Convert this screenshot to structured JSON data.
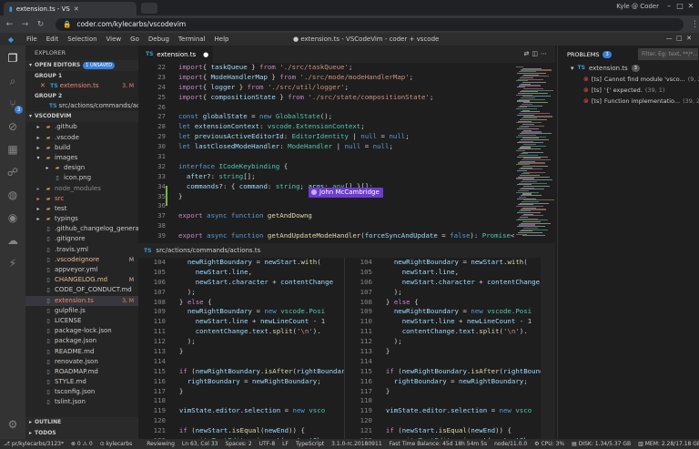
{
  "browser": {
    "tab_title": "extension.ts - VS",
    "url": "coder.com/kylecarbs/vscodevim",
    "user": "Kyle @ Coder"
  },
  "menu": {
    "items": [
      "File",
      "Edit",
      "Selection",
      "View",
      "Go",
      "Debug",
      "Terminal",
      "Help"
    ],
    "window_title": "● extension.ts - VSCodeVim - coder + vscode"
  },
  "activity": {
    "badge": "3"
  },
  "sidebar": {
    "title": "EXPLORER",
    "open_editors": "OPEN EDITORS",
    "unsaved": "1 UNSAVED",
    "group1": "GROUP 1",
    "group1_file": {
      "name": "extension.ts",
      "mark": "3, M"
    },
    "group2": "GROUP 2",
    "group2_file": {
      "name": "src/actions/commands/action..."
    },
    "root": "VSCODEVIM",
    "tree": [
      {
        "name": ".github",
        "kind": "folder",
        "level": 1,
        "state": "",
        "mark": ""
      },
      {
        "name": ".vscode",
        "kind": "folder",
        "level": 1,
        "state": "",
        "mark": ""
      },
      {
        "name": "build",
        "kind": "folder",
        "level": 1,
        "state": "",
        "mark": ""
      },
      {
        "name": "images",
        "kind": "folder-open",
        "level": 1,
        "state": "",
        "mark": ""
      },
      {
        "name": "design",
        "kind": "folder",
        "level": 2,
        "state": "",
        "mark": ""
      },
      {
        "name": "icon.png",
        "kind": "file",
        "level": 2,
        "state": "",
        "mark": ""
      },
      {
        "name": "node_modules",
        "kind": "folder",
        "level": 1,
        "state": "ignored",
        "mark": ""
      },
      {
        "name": "src",
        "kind": "folder",
        "level": 1,
        "state": "err",
        "mark": ""
      },
      {
        "name": "test",
        "kind": "folder",
        "level": 1,
        "state": "",
        "mark": ""
      },
      {
        "name": "typings",
        "kind": "folder",
        "level": 1,
        "state": "",
        "mark": ""
      },
      {
        "name": ".github_changelog_generator",
        "kind": "file",
        "level": 1,
        "state": "",
        "mark": ""
      },
      {
        "name": ".gitignore",
        "kind": "file",
        "level": 1,
        "state": "",
        "mark": ""
      },
      {
        "name": ".travis.yml",
        "kind": "file",
        "level": 1,
        "state": "",
        "mark": ""
      },
      {
        "name": ".vscodeignore",
        "kind": "file",
        "level": 1,
        "state": "modified",
        "mark": "M"
      },
      {
        "name": "appveyor.yml",
        "kind": "file",
        "level": 1,
        "state": "",
        "mark": ""
      },
      {
        "name": "CHANGELOG.md",
        "kind": "file",
        "level": 1,
        "state": "modified",
        "mark": "M"
      },
      {
        "name": "CODE_OF_CONDUCT.md",
        "kind": "file",
        "level": 1,
        "state": "",
        "mark": ""
      },
      {
        "name": "extension.ts",
        "kind": "file",
        "level": 1,
        "state": "err",
        "mark": "3, M"
      },
      {
        "name": "gulpfile.js",
        "kind": "file",
        "level": 1,
        "state": "",
        "mark": ""
      },
      {
        "name": "LICENSE",
        "kind": "file",
        "level": 1,
        "state": "",
        "mark": ""
      },
      {
        "name": "package-lock.json",
        "kind": "file",
        "level": 1,
        "state": "",
        "mark": ""
      },
      {
        "name": "package.json",
        "kind": "file",
        "level": 1,
        "state": "",
        "mark": ""
      },
      {
        "name": "README.md",
        "kind": "file",
        "level": 1,
        "state": "",
        "mark": ""
      },
      {
        "name": "renovate.json",
        "kind": "file",
        "level": 1,
        "state": "",
        "mark": ""
      },
      {
        "name": "ROADMAP.md",
        "kind": "file",
        "level": 1,
        "state": "",
        "mark": ""
      },
      {
        "name": "STYLE.md",
        "kind": "file",
        "level": 1,
        "state": "",
        "mark": ""
      },
      {
        "name": "tsconfig.json",
        "kind": "file",
        "level": 1,
        "state": "",
        "mark": ""
      },
      {
        "name": "tslint.json",
        "kind": "file",
        "level": 1,
        "state": "",
        "mark": ""
      }
    ],
    "outline": "OUTLINE",
    "todos": "TODOS"
  },
  "editor_top": {
    "tab": "extension.ts",
    "line_numbers": [
      "22",
      "23",
      "24",
      "25",
      "26",
      "27",
      "28",
      "29",
      "30",
      "31",
      "32",
      "33",
      "34",
      "35",
      "36",
      "37",
      "38",
      "39",
      "40"
    ],
    "code": [
      [
        [
          "kw",
          "import"
        ],
        [
          "",
          "{ "
        ],
        [
          "vr",
          "taskQueue"
        ],
        [
          "",
          " } "
        ],
        [
          "kw",
          "from"
        ],
        [
          "",
          " "
        ],
        [
          "st",
          "'./src/taskQueue'"
        ],
        [
          "",
          ";"
        ]
      ],
      [
        [
          "kw",
          "import"
        ],
        [
          "",
          "{ "
        ],
        [
          "vr",
          "ModeHandlerMap"
        ],
        [
          "",
          " } "
        ],
        [
          "kw",
          "from"
        ],
        [
          "",
          " "
        ],
        [
          "st",
          "'./src/mode/modeHandlerMap'"
        ],
        [
          "",
          ";"
        ]
      ],
      [
        [
          "kw",
          "import"
        ],
        [
          "",
          "{ "
        ],
        [
          "vr",
          "logger"
        ],
        [
          "",
          " } "
        ],
        [
          "kw",
          "from"
        ],
        [
          "",
          " "
        ],
        [
          "st",
          "'./src/util/logger'"
        ],
        [
          "",
          ";"
        ]
      ],
      [
        [
          "kw",
          "import"
        ],
        [
          "",
          "{ "
        ],
        [
          "vr",
          "compositionState"
        ],
        [
          "",
          " } "
        ],
        [
          "kw",
          "from"
        ],
        [
          "",
          " "
        ],
        [
          "st",
          "'./src/state/compositionState'"
        ],
        [
          "",
          ";"
        ]
      ],
      [
        [
          "",
          ""
        ]
      ],
      [
        [
          "kb",
          "const"
        ],
        [
          "",
          " "
        ],
        [
          "vr",
          "globalState"
        ],
        [
          "",
          " = "
        ],
        [
          "kb",
          "new"
        ],
        [
          "",
          " "
        ],
        [
          "ty",
          "GlobalState"
        ],
        [
          "",
          "();"
        ]
      ],
      [
        [
          "kb",
          "let"
        ],
        [
          "",
          " "
        ],
        [
          "vr",
          "extensionContext"
        ],
        [
          "",
          ": "
        ],
        [
          "ty",
          "vscode.ExtensionContext"
        ],
        [
          "",
          ";"
        ]
      ],
      [
        [
          "kb",
          "let"
        ],
        [
          "",
          " "
        ],
        [
          "vr",
          "previousActiveEditorId"
        ],
        [
          "",
          ": "
        ],
        [
          "ty",
          "EditorIdentity"
        ],
        [
          "",
          " | "
        ],
        [
          "kb",
          "null"
        ],
        [
          "",
          " = "
        ],
        [
          "kb",
          "null"
        ],
        [
          "",
          ";"
        ]
      ],
      [
        [
          "kb",
          "let"
        ],
        [
          "",
          " "
        ],
        [
          "vr",
          "lastClosedModeHandler"
        ],
        [
          "",
          ": "
        ],
        [
          "ty",
          "ModeHandler"
        ],
        [
          "",
          " | "
        ],
        [
          "kb",
          "null"
        ],
        [
          "",
          " = "
        ],
        [
          "kb",
          "null"
        ],
        [
          "",
          ";"
        ]
      ],
      [
        [
          "",
          ""
        ]
      ],
      [
        [
          "kb",
          "interface"
        ],
        [
          "",
          " "
        ],
        [
          "ty",
          "ICodeKeybinding"
        ],
        [
          "",
          " {"
        ]
      ],
      [
        [
          "",
          "  "
        ],
        [
          "vr",
          "after"
        ],
        [
          "",
          "?: "
        ],
        [
          "ty",
          "string"
        ],
        [
          "",
          "[];"
        ]
      ],
      [
        [
          "",
          "  "
        ],
        [
          "vr",
          "commands"
        ],
        [
          "",
          "?: { "
        ],
        [
          "vr",
          "command"
        ],
        [
          "",
          ": "
        ],
        [
          "ty",
          "string"
        ],
        [
          "",
          "; "
        ],
        [
          "vr",
          "args"
        ],
        [
          "",
          ": "
        ],
        [
          "ty",
          "any"
        ],
        [
          "",
          "[] }[];"
        ]
      ],
      [
        [
          "",
          "}"
        ]
      ],
      [
        [
          "",
          ""
        ]
      ],
      [
        [
          "kw",
          "export"
        ],
        [
          "",
          " "
        ],
        [
          "kb",
          "async"
        ],
        [
          "",
          " "
        ],
        [
          "kb",
          "function"
        ],
        [
          "",
          " "
        ],
        [
          "fn",
          "getAndDowng"
        ]
      ],
      [
        [
          "",
          ""
        ]
      ],
      [
        [
          "kw",
          "export"
        ],
        [
          "",
          " "
        ],
        [
          "kb",
          "async"
        ],
        [
          "",
          " "
        ],
        [
          "kb",
          "function"
        ],
        [
          "",
          " "
        ],
        [
          "fn",
          "getAndUpdateModeHandler"
        ],
        [
          "",
          "("
        ],
        [
          "vr",
          "forceSyncAndUpdate"
        ],
        [
          "",
          " = "
        ],
        [
          "kb",
          "false"
        ],
        [
          "",
          "): "
        ],
        [
          "ty",
          "Promise"
        ],
        [
          "",
          "<Mo"
        ]
      ],
      [
        [
          "",
          "  "
        ],
        [
          "kb",
          "const"
        ],
        [
          "",
          " "
        ],
        [
          "vr",
          "activeEditorId"
        ],
        [
          "",
          " = "
        ],
        [
          "kb",
          "new"
        ],
        [
          "",
          " "
        ],
        [
          "ty",
          "EditorIdentity"
        ],
        [
          "",
          "("
        ],
        [
          "vr",
          "vscode.window.activeTextEditor"
        ],
        [
          "",
          ");"
        ]
      ]
    ],
    "collaborator": "John McCambridge"
  },
  "editor_bottom": {
    "tab": "src/actions/commands/actions.ts",
    "line_numbers": [
      "104",
      "105",
      "106",
      "107",
      "108",
      "109",
      "110",
      "111",
      "112",
      "113",
      "114",
      "115",
      "116",
      "117",
      "118",
      "119",
      "120",
      "121",
      "122",
      "123"
    ],
    "code": [
      [
        [
          "",
          "    "
        ],
        [
          "vr",
          "newRightBoundary"
        ],
        [
          "",
          " = "
        ],
        [
          "vr",
          "newStart"
        ],
        [
          "",
          "."
        ],
        [
          "fn",
          "with"
        ],
        [
          "",
          "("
        ]
      ],
      [
        [
          "",
          "      "
        ],
        [
          "vr",
          "newStart"
        ],
        [
          "",
          "."
        ],
        [
          "vr",
          "line"
        ],
        [
          "",
          ","
        ]
      ],
      [
        [
          "",
          "      "
        ],
        [
          "vr",
          "newStart"
        ],
        [
          "",
          "."
        ],
        [
          "vr",
          "character"
        ],
        [
          "",
          " + "
        ],
        [
          "vr",
          "contentChange"
        ]
      ],
      [
        [
          "",
          "    );"
        ]
      ],
      [
        [
          "",
          "  } "
        ],
        [
          "kw",
          "else"
        ],
        [
          "",
          " {"
        ]
      ],
      [
        [
          "",
          "    "
        ],
        [
          "vr",
          "newRightBoundary"
        ],
        [
          "",
          " = "
        ],
        [
          "kb",
          "new"
        ],
        [
          "",
          " "
        ],
        [
          "ty",
          "vscode.Posi"
        ]
      ],
      [
        [
          "",
          "      "
        ],
        [
          "vr",
          "newStart"
        ],
        [
          "",
          "."
        ],
        [
          "vr",
          "line"
        ],
        [
          "",
          " + "
        ],
        [
          "vr",
          "newLineCount"
        ],
        [
          "",
          " - "
        ],
        [
          "nm",
          "1"
        ]
      ],
      [
        [
          "",
          "      "
        ],
        [
          "vr",
          "contentChange"
        ],
        [
          "",
          "."
        ],
        [
          "vr",
          "text"
        ],
        [
          "",
          "."
        ],
        [
          "fn",
          "split"
        ],
        [
          "",
          "("
        ],
        [
          "st",
          "'\\n'"
        ],
        [
          "",
          ")."
        ]
      ],
      [
        [
          "",
          "    );"
        ]
      ],
      [
        [
          "",
          "  }"
        ]
      ],
      [
        [
          "",
          ""
        ]
      ],
      [
        [
          "",
          "  "
        ],
        [
          "kw",
          "if"
        ],
        [
          "",
          " ("
        ],
        [
          "vr",
          "newRightBoundary"
        ],
        [
          "",
          "."
        ],
        [
          "fn",
          "isAfter"
        ],
        [
          "",
          "("
        ],
        [
          "vr",
          "rightBoundary"
        ],
        [
          "",
          ")"
        ]
      ],
      [
        [
          "",
          "    "
        ],
        [
          "vr",
          "rightBoundary"
        ],
        [
          "",
          " = "
        ],
        [
          "vr",
          "newRightBoundary"
        ],
        [
          "",
          ";"
        ]
      ],
      [
        [
          "",
          "  }"
        ]
      ],
      [
        [
          "",
          ""
        ]
      ],
      [
        [
          "",
          "  "
        ],
        [
          "vr",
          "vimState"
        ],
        [
          "",
          "."
        ],
        [
          "vr",
          "editor"
        ],
        [
          "",
          "."
        ],
        [
          "vr",
          "selection"
        ],
        [
          "",
          " = "
        ],
        [
          "kb",
          "new"
        ],
        [
          "",
          " "
        ],
        [
          "ty",
          "vsco"
        ]
      ],
      [
        [
          "",
          ""
        ]
      ],
      [
        [
          "",
          "  "
        ],
        [
          "kw",
          "if"
        ],
        [
          "",
          " ("
        ],
        [
          "vr",
          "newStart"
        ],
        [
          "",
          "."
        ],
        [
          "fn",
          "isEqual"
        ],
        [
          "",
          "("
        ],
        [
          "vr",
          "newEnd"
        ],
        [
          "",
          ")) {"
        ]
      ],
      [
        [
          "",
          "    "
        ],
        [
          "kw",
          "await"
        ],
        [
          "",
          " "
        ],
        [
          "ty",
          "TextEditor"
        ],
        [
          "",
          "."
        ],
        [
          "fn",
          "insert"
        ],
        [
          "",
          "("
        ],
        [
          "vr",
          "contentChan"
        ]
      ],
      [
        [
          "",
          "  } "
        ],
        [
          "kw",
          "else"
        ],
        [
          "",
          " {"
        ]
      ]
    ]
  },
  "problems": {
    "title": "PROBLEMS",
    "count": "3",
    "filter_placeholder": "Filter. Eg: text, **/*...",
    "file": "extension.ts",
    "file_count": "3",
    "items": [
      {
        "source": "[ts]",
        "msg": "Cannot find module 'vsco...",
        "loc": "(9, 25)"
      },
      {
        "source": "[ts]",
        "msg": "'{' expected.",
        "loc": "(39, 1)"
      },
      {
        "source": "[ts]",
        "msg": "Function implementatio...",
        "loc": "(39, 23)"
      }
    ]
  },
  "status": {
    "left": [
      "⎇ pr/kylecarbs/3123*",
      "⊗ 0 ⚠ 0",
      "⊙ kylecarbs"
    ],
    "right": [
      "Reviewing",
      "Ln 63, Col 33",
      "Spaces: 2",
      "UTF-8",
      "LF",
      "TypeScript",
      "3.1.0-rc.20180911",
      "Fast Time Balance: 45d 18h 54m 5s",
      "node/11.0.0",
      "⚙ CPU: 3%",
      "▤ DISK: 1.34/5.37 GB",
      "▥ MEM: 2.28/17.18 GB",
      "☺"
    ]
  }
}
